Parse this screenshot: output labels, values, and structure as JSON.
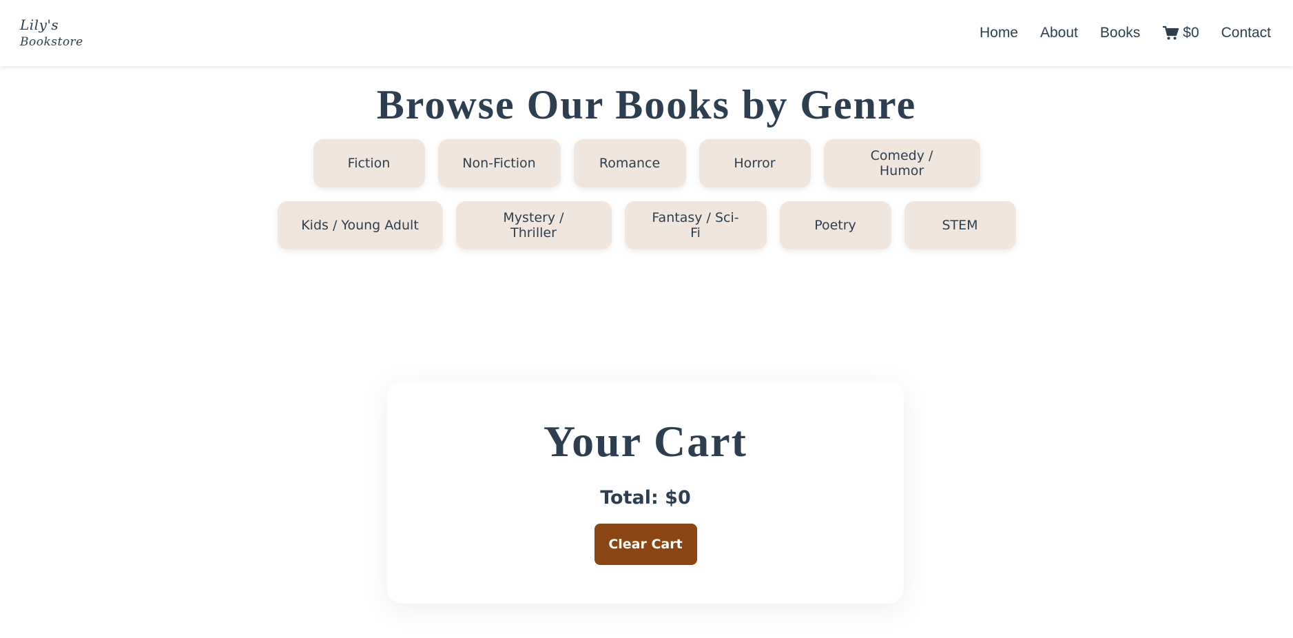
{
  "nav": {
    "logo_line1": "Lily's",
    "logo_line2": "Bookstore",
    "links": {
      "home": "Home",
      "about": "About",
      "books": "Books",
      "cart": "$0",
      "contact": "Contact"
    },
    "cart_icon": "cart-icon"
  },
  "main": {
    "title": "Browse Our Books by Genre",
    "genres_row1": [
      "Fiction",
      "Non-Fiction",
      "Romance",
      "Horror",
      "Comedy / Humor"
    ],
    "genres_row2": [
      "Kids / Young Adult",
      "Mystery / Thriller",
      "Fantasy / Sci-Fi",
      "Poetry",
      "STEM"
    ]
  },
  "cart": {
    "title": "Your Cart",
    "total": "Total: $0",
    "clear_label": "Clear Cart"
  },
  "colors": {
    "text": "#2c3e50",
    "genre_bg": "#f0e6de",
    "accent": "#8b4513"
  }
}
